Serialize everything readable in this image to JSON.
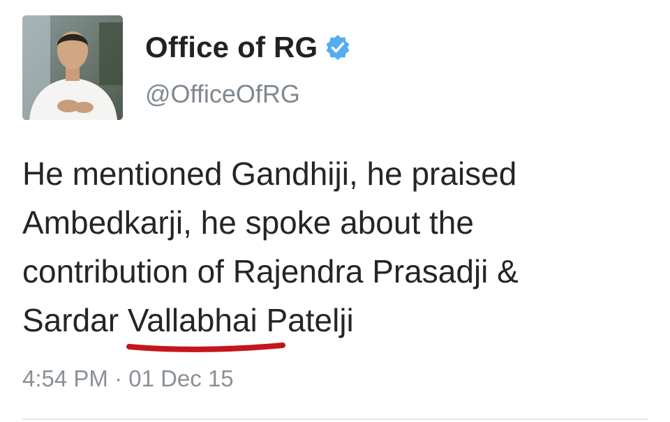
{
  "author": {
    "display_name": "Office of RG",
    "handle": "@OfficeOfRG",
    "verified": true,
    "avatar_icon": "profile-photo"
  },
  "tweet": {
    "lines": [
      "He mentioned Gandhiji, he praised",
      "Ambedkarji, he spoke about the",
      "contribution of Rajendra Prasadji &"
    ],
    "last_line_prefix": "Sardar ",
    "highlighted_word": "Vallabhai",
    "last_line_suffix": " Patelji",
    "timestamp": "4:54 PM · 01 Dec 15"
  },
  "colors": {
    "verified_badge": "#55acee",
    "underline_mark": "#c4161c",
    "handle": "#7f8890",
    "timestamp": "#8a9096"
  }
}
